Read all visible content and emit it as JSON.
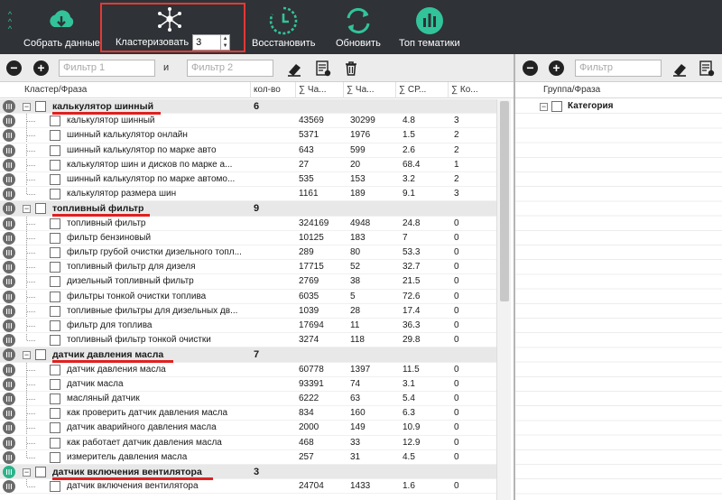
{
  "toolbar": {
    "collect_label": "Собрать данные",
    "cluster_label": "Кластеризовать",
    "cluster_value": "3",
    "restore_label": "Восстановить",
    "refresh_label": "Обновить",
    "topics_label": "Топ тематики"
  },
  "filters": {
    "filter1_placeholder": "Фильтр 1",
    "and_label": "и",
    "filter2_placeholder": "Фильтр 2",
    "right_placeholder": "Фильтр"
  },
  "grid": {
    "headers": {
      "phrase": "Кластер/Фраза",
      "count": "кол-во",
      "c1": "Ча...",
      "c2": "Ча...",
      "c3": "СР...",
      "c4": "Ко..."
    },
    "clusters": [
      {
        "name": "калькулятор шинный",
        "count": "6",
        "rows": [
          [
            "калькулятор шинный",
            "43569",
            "30299",
            "4.8",
            "3"
          ],
          [
            "шинный калькулятор онлайн",
            "5371",
            "1976",
            "1.5",
            "2"
          ],
          [
            "шинный калькулятор по марке авто",
            "643",
            "599",
            "2.6",
            "2"
          ],
          [
            "калькулятор шин и дисков по марке а...",
            "27",
            "20",
            "68.4",
            "1"
          ],
          [
            "шинный калькулятор по марке автомо...",
            "535",
            "153",
            "3.2",
            "2"
          ],
          [
            "калькулятор размера шин",
            "1161",
            "189",
            "9.1",
            "3"
          ]
        ]
      },
      {
        "name": "топливный фильтр",
        "count": "9",
        "rows": [
          [
            "топливный фильтр",
            "324169",
            "4948",
            "24.8",
            "0"
          ],
          [
            "фильтр бензиновый",
            "10125",
            "183",
            "7",
            "0"
          ],
          [
            "фильтр грубой очистки дизельного топл...",
            "289",
            "80",
            "53.3",
            "0"
          ],
          [
            "топливный фильтр для дизеля",
            "17715",
            "52",
            "32.7",
            "0"
          ],
          [
            "дизельный топливный фильтр",
            "2769",
            "38",
            "21.5",
            "0"
          ],
          [
            "фильтры тонкой очистки топлива",
            "6035",
            "5",
            "72.6",
            "0"
          ],
          [
            "топливные фильтры для дизельных дв...",
            "1039",
            "28",
            "17.4",
            "0"
          ],
          [
            "фильтр для топлива",
            "17694",
            "11",
            "36.3",
            "0"
          ],
          [
            "топливный фильтр тонкой очистки",
            "3274",
            "118",
            "29.8",
            "0"
          ]
        ]
      },
      {
        "name": "датчик давления масла",
        "count": "7",
        "rows": [
          [
            "датчик давления масла",
            "60778",
            "1397",
            "11.5",
            "0"
          ],
          [
            "датчик масла",
            "93391",
            "74",
            "3.1",
            "0"
          ],
          [
            "масляный датчик",
            "6222",
            "63",
            "5.4",
            "0"
          ],
          [
            "как проверить датчик давления масла",
            "834",
            "160",
            "6.3",
            "0"
          ],
          [
            "датчик аварийного давления масла",
            "2000",
            "149",
            "10.9",
            "0"
          ],
          [
            "как работает датчик давления масла",
            "468",
            "33",
            "12.9",
            "0"
          ],
          [
            "измеритель давления масла",
            "257",
            "31",
            "4.5",
            "0"
          ]
        ]
      },
      {
        "name": "датчик включения вентилятора",
        "count": "3",
        "rows": [
          [
            "датчик включения вентилятора",
            "24704",
            "1433",
            "1.6",
            "0"
          ]
        ]
      }
    ]
  },
  "right_pane": {
    "header": "Группа/Фраза",
    "category_label": "Категория"
  },
  "colors": {
    "toolbar_bg": "#2f3237",
    "accent": "#2bb38a",
    "highlight": "#e53935"
  }
}
